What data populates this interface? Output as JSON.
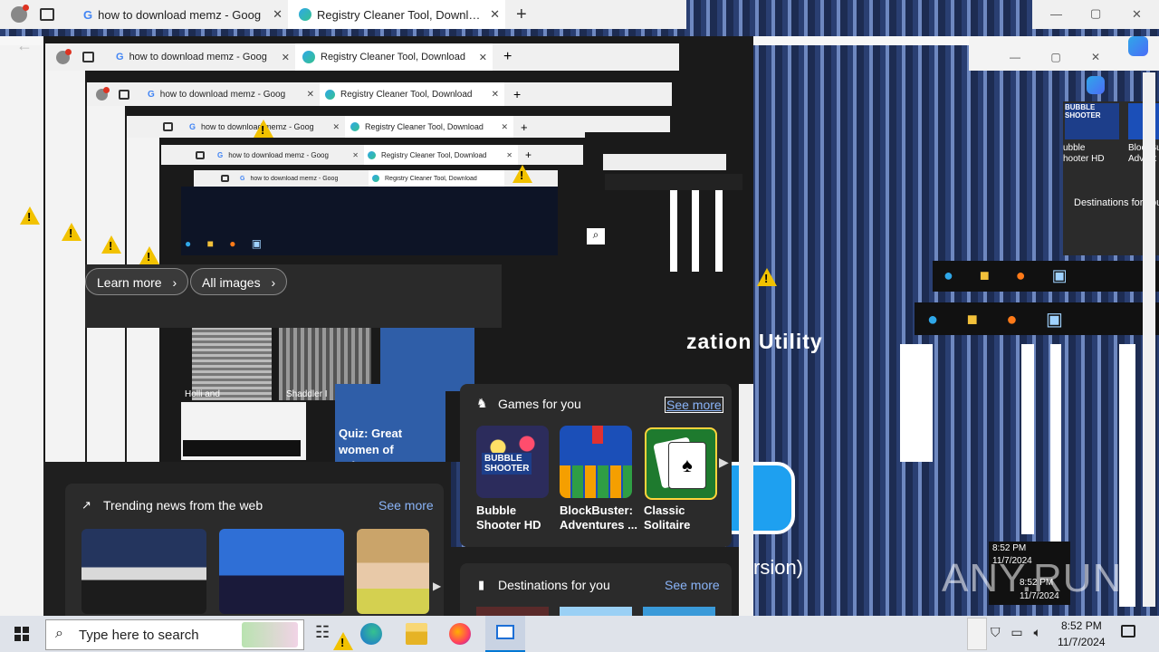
{
  "browser": {
    "tabs": [
      {
        "label": "how to download memz - Goog",
        "favicon": "google-icon"
      },
      {
        "label": "Registry Cleaner Tool, Download",
        "favicon": "edge-icon"
      }
    ],
    "new_tab": "+",
    "window_controls": {
      "minimize": "—",
      "maximize": "▢",
      "close": "✕"
    }
  },
  "image_search": {
    "learn_more": "Learn more",
    "all_images": "All images",
    "thumb_captions": [
      "Holli and",
      "Shaddler I"
    ]
  },
  "quiz_card": {
    "title": "Quiz: Great women of science"
  },
  "games": {
    "heading": "Games for you",
    "see_more": "See more",
    "items": [
      {
        "name": "Bubble Shooter HD",
        "line1": "Bubble",
        "line2": "Shooter HD"
      },
      {
        "name": "BlockBuster: Adventures ...",
        "line1": "BlockBuster:",
        "line2": "Adventures ..."
      },
      {
        "name": "Classic Solitaire",
        "line1": "Classic",
        "line2": "Solitaire"
      }
    ]
  },
  "trending": {
    "heading": "Trending news from the web",
    "see_more": "See more"
  },
  "destinations": {
    "heading": "Destinations for you",
    "see_more": "See more"
  },
  "right_panel": {
    "mini_games": [
      {
        "line1": "ubble",
        "line2": "hooter HD"
      },
      {
        "line1": "BlockBu",
        "line2": "Advent"
      }
    ],
    "destinations_heading": "Destinations for you"
  },
  "background_text": {
    "optimization": "zation Utility",
    "version": "rsion)"
  },
  "watermark": "ANY.RUN",
  "taskbar": {
    "search_placeholder": "Type here to search",
    "time": "8:52 PM",
    "date": "11/7/2024",
    "nested_time": "8:52 PM",
    "nested_date": "11/7/2024"
  },
  "colors": {
    "accent": "#0078d4",
    "taskbar": "#dfe3ea",
    "panel": "#2b2b2b",
    "link": "#8ab4f8"
  }
}
